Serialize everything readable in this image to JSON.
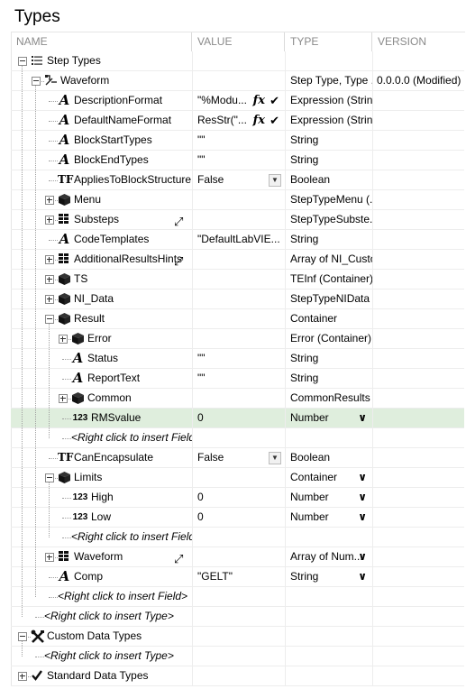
{
  "title": "Types",
  "columns": {
    "name": "NAME",
    "value": "VALUE",
    "type": "TYPE",
    "version": "VERSION"
  },
  "rows": [
    {
      "name": "Step Types",
      "value": "",
      "type": "",
      "version": ""
    },
    {
      "name": "Waveform",
      "value": "",
      "type": "Step Type, Type ...",
      "version": "0.0.0.0 (Modified)"
    },
    {
      "name": "DescriptionFormat",
      "value": "\"%Modu...",
      "type": "Expression (String)",
      "version": ""
    },
    {
      "name": "DefaultNameFormat",
      "value": "ResStr(\"...",
      "type": "Expression (String)",
      "version": ""
    },
    {
      "name": "BlockStartTypes",
      "value": "\"\"",
      "type": "String",
      "version": ""
    },
    {
      "name": "BlockEndTypes",
      "value": "\"\"",
      "type": "String",
      "version": ""
    },
    {
      "name": "AppliesToBlockStructure",
      "value": "False",
      "type": "Boolean",
      "version": ""
    },
    {
      "name": "Menu",
      "value": "",
      "type": "StepTypeMenu (...",
      "version": ""
    },
    {
      "name": "Substeps",
      "value": "",
      "type": "StepTypeSubste...",
      "version": ""
    },
    {
      "name": "CodeTemplates",
      "value": "\"DefaultLabVIE...",
      "type": "String",
      "version": ""
    },
    {
      "name": "AdditionalResultsHints",
      "value": "",
      "type": "Array of NI_Custo...",
      "version": ""
    },
    {
      "name": "TS",
      "value": "",
      "type": "TEInf (Container)",
      "version": ""
    },
    {
      "name": "NI_Data",
      "value": "",
      "type": "StepTypeNIData ...",
      "version": ""
    },
    {
      "name": "Result",
      "value": "",
      "type": "Container",
      "version": ""
    },
    {
      "name": "Error",
      "value": "",
      "type": "Error (Container)",
      "version": ""
    },
    {
      "name": "Status",
      "value": "\"\"",
      "type": "String",
      "version": ""
    },
    {
      "name": "ReportText",
      "value": "\"\"",
      "type": "String",
      "version": ""
    },
    {
      "name": "Common",
      "value": "",
      "type": "CommonResults (...",
      "version": ""
    },
    {
      "name": "RMSvalue",
      "value": "0",
      "type": "Number",
      "version": ""
    },
    {
      "name": "<Right click to insert Field>",
      "value": "",
      "type": "",
      "version": ""
    },
    {
      "name": "CanEncapsulate",
      "value": "False",
      "type": "Boolean",
      "version": ""
    },
    {
      "name": "Limits",
      "value": "",
      "type": "Container",
      "version": ""
    },
    {
      "name": "High",
      "value": "0",
      "type": "Number",
      "version": ""
    },
    {
      "name": "Low",
      "value": "0",
      "type": "Number",
      "version": ""
    },
    {
      "name": "<Right click to insert Field>",
      "value": "",
      "type": "",
      "version": ""
    },
    {
      "name": "Waveform",
      "value": "",
      "type": "Array of Num...",
      "version": ""
    },
    {
      "name": "Comp",
      "value": "\"GELT\"",
      "type": "String",
      "version": ""
    },
    {
      "name": "<Right click to insert Field>",
      "value": "",
      "type": "",
      "version": ""
    },
    {
      "name": "<Right click to insert Type>",
      "value": "",
      "type": "",
      "version": ""
    },
    {
      "name": "Custom Data Types",
      "value": "",
      "type": "",
      "version": ""
    },
    {
      "name": "<Right click to insert Type>",
      "value": "",
      "type": "",
      "version": ""
    },
    {
      "name": "Standard Data Types",
      "value": "",
      "type": "",
      "version": ""
    }
  ],
  "icons": {
    "step_types": "list-icon",
    "waveform_step": "step-type-icon",
    "string": "script-a-icon",
    "boolean": "tf-icon",
    "container": "cube-icon",
    "array": "grid-icon",
    "number": "123-icon",
    "custom": "tools-icon",
    "standard": "checkmark-icon"
  },
  "colors": {
    "selected_row": "#dfeedd",
    "header_text": "#8a8a8a",
    "grid_line": "#ededed"
  }
}
